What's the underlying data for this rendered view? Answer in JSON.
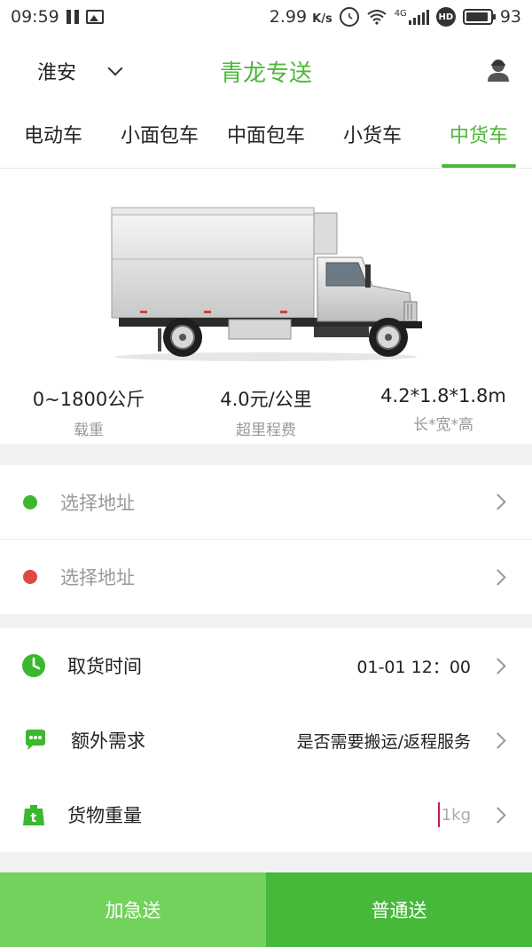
{
  "status_bar": {
    "time": "09:59",
    "speed": "2.99",
    "speed_unit": "K/s",
    "network": "4G",
    "hd": "HD",
    "battery": "93",
    "battery_level_percent": 93
  },
  "header": {
    "city": "淮安",
    "title": "青龙专送"
  },
  "tabs": [
    {
      "label": "电动车",
      "active": false
    },
    {
      "label": "小面包车",
      "active": false
    },
    {
      "label": "中面包车",
      "active": false
    },
    {
      "label": "小货车",
      "active": false
    },
    {
      "label": "中货车",
      "active": true
    }
  ],
  "vehicle": {
    "specs": [
      {
        "value": "0~1800公斤",
        "label": "载重"
      },
      {
        "value": "4.0元/公里",
        "label": "超里程费"
      },
      {
        "value": "4.2*1.8*1.8m",
        "label": "长*宽*高"
      }
    ]
  },
  "addresses": {
    "start": {
      "placeholder": "选择地址",
      "dot_color": "#3cb82f"
    },
    "end": {
      "placeholder": "选择地址",
      "dot_color": "#e04848"
    }
  },
  "options": {
    "pickup_time": {
      "label": "取货时间",
      "value": "01-01 12：00",
      "icon": "clock-icon"
    },
    "extra": {
      "label": "额外需求",
      "value": "是否需要搬运/返程服务",
      "icon": "chat-bubble-icon"
    },
    "weight": {
      "label": "货物重量",
      "placeholder": "1kg",
      "icon": "weight-icon"
    }
  },
  "buttons": {
    "urgent": "加急送",
    "normal": "普通送"
  },
  "colors": {
    "brand_green": "#4cb83a",
    "urgent_button": "#72d25c",
    "normal_button": "#46b83a"
  }
}
